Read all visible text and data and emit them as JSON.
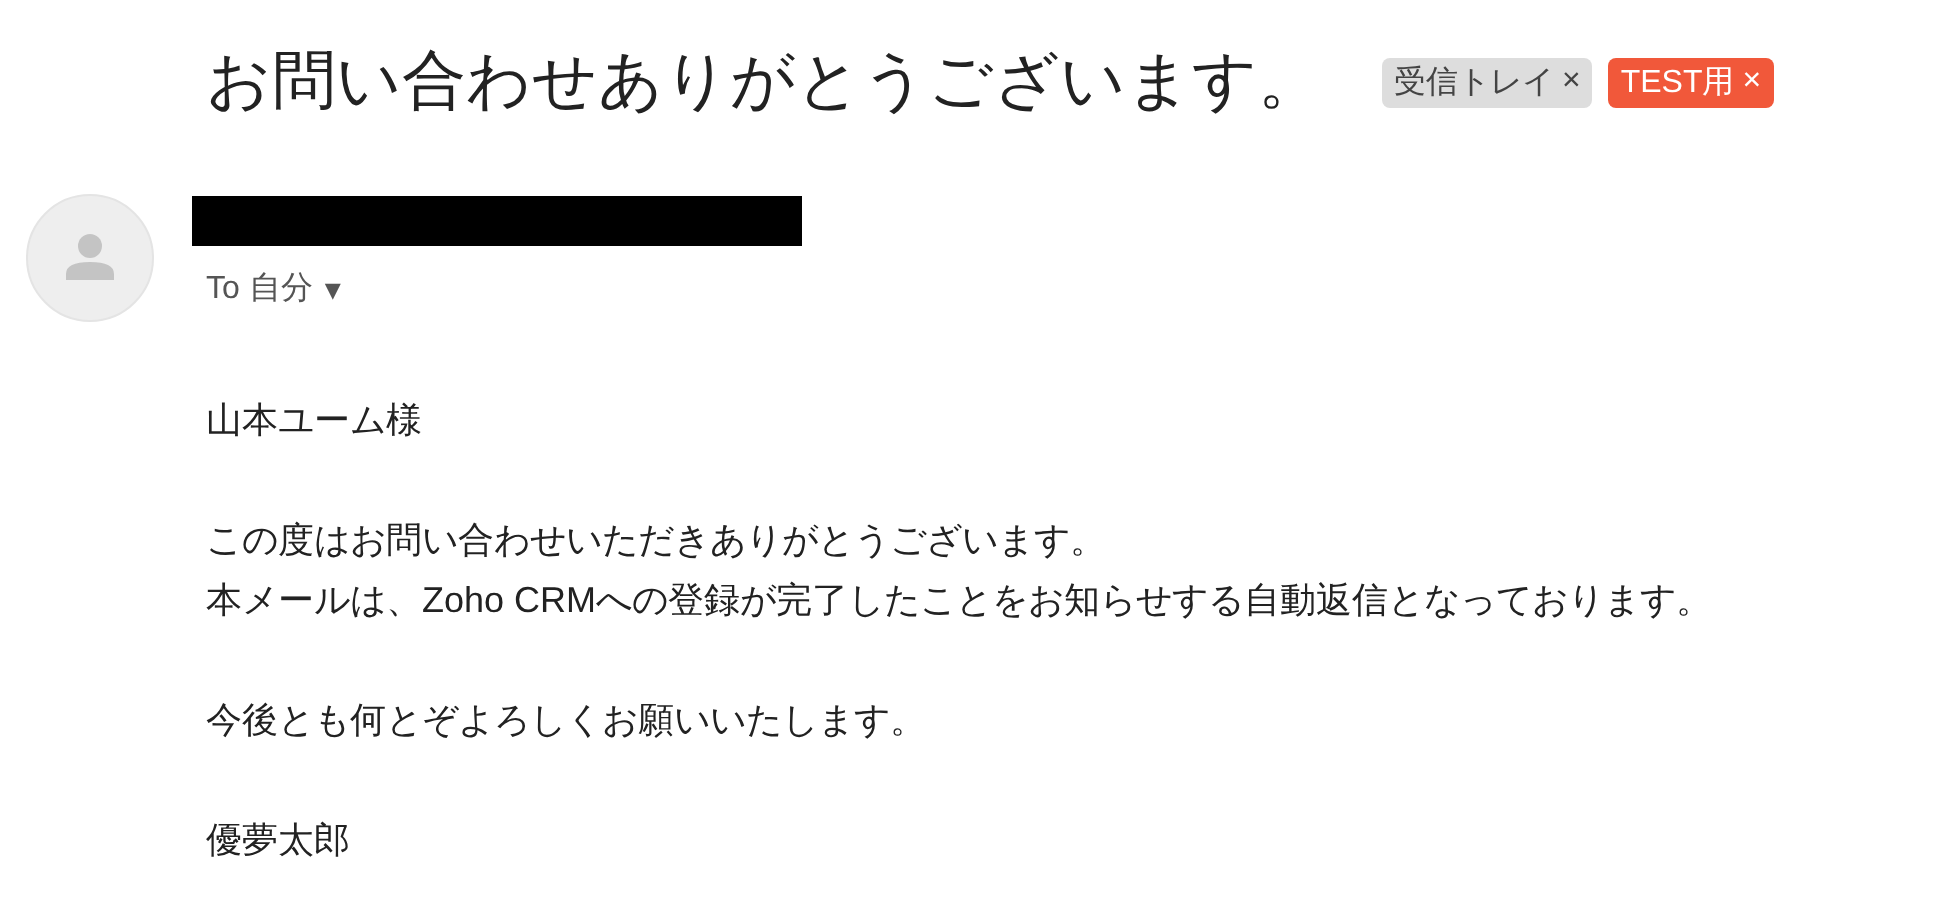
{
  "subject": "お問い合わせありがとうございます。",
  "labels": [
    {
      "text": "受信トレイ",
      "close": "×",
      "color": "#dddddd"
    },
    {
      "text": "TEST用",
      "close": "×",
      "color": "#f1583a"
    }
  ],
  "sender": {
    "redacted": true,
    "to": "To 自分",
    "menu": "▾"
  },
  "body": [
    [
      "山本ユーム様"
    ],
    [
      "この度はお問い合わせいただきありがとうございます。",
      "本メールは、Zoho CRMへの登録が完了したことをお知らせする自動返信となっております。"
    ],
    [
      "今後とも何とぞよろしくお願いいたします。"
    ],
    [
      "優夢太郎"
    ]
  ]
}
